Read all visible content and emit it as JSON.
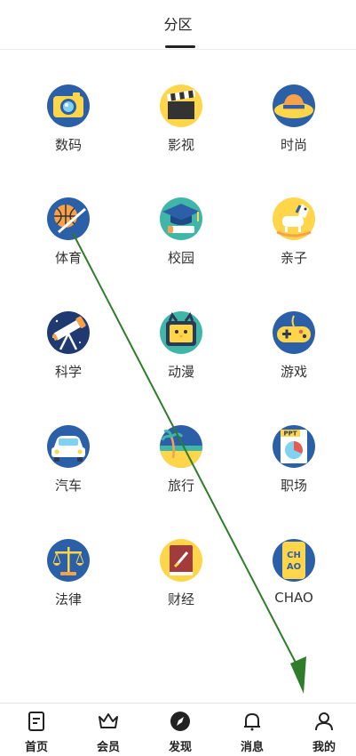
{
  "header": {
    "title": "分区"
  },
  "categories": [
    {
      "label": "数码",
      "icon": "camera-icon"
    },
    {
      "label": "影视",
      "icon": "clapperboard-icon"
    },
    {
      "label": "时尚",
      "icon": "sun-hat-icon"
    },
    {
      "label": "体育",
      "icon": "basketball-icon"
    },
    {
      "label": "校园",
      "icon": "graduation-cap-icon"
    },
    {
      "label": "亲子",
      "icon": "rocking-horse-icon"
    },
    {
      "label": "科学",
      "icon": "telescope-icon"
    },
    {
      "label": "动漫",
      "icon": "cartoon-tv-icon"
    },
    {
      "label": "游戏",
      "icon": "gamepad-icon"
    },
    {
      "label": "汽车",
      "icon": "car-icon"
    },
    {
      "label": "旅行",
      "icon": "beach-palm-icon"
    },
    {
      "label": "职场",
      "icon": "ppt-chart-icon"
    },
    {
      "label": "法律",
      "icon": "scales-icon"
    },
    {
      "label": "财经",
      "icon": "finance-book-icon"
    },
    {
      "label": "CHAO",
      "icon": "chao-phone-icon"
    }
  ],
  "tabbar": {
    "items": [
      {
        "label": "首页",
        "icon": "home-doc-icon"
      },
      {
        "label": "会员",
        "icon": "crown-icon"
      },
      {
        "label": "发现",
        "icon": "compass-icon"
      },
      {
        "label": "消息",
        "icon": "bell-icon"
      },
      {
        "label": "我的",
        "icon": "person-icon"
      }
    ]
  },
  "colors": {
    "circle_yellow": "#ffd54a",
    "circle_blue": "#2b5fa8",
    "accent_orange": "#f7a14a",
    "annotation_green": "#2f7d2a"
  }
}
